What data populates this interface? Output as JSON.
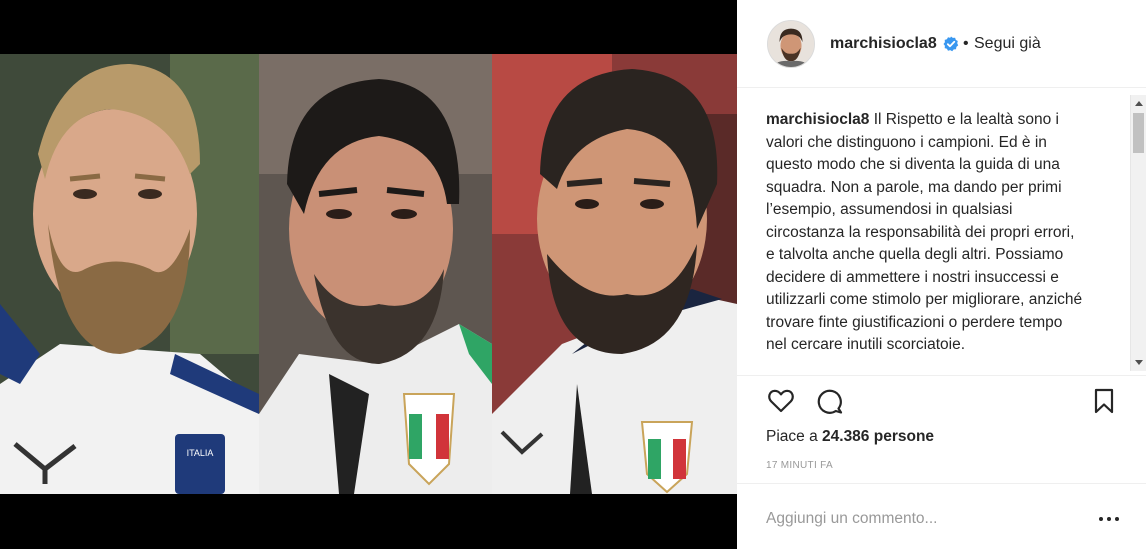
{
  "post": {
    "image_alt": "Tre ritratti di calciatori della nazionale italiana",
    "panels": [
      {
        "name": "player-1",
        "hair": "#b89a6a",
        "beard": "#8a6a44",
        "skin": "#d9a88a",
        "shirt": "#f2f2f2",
        "bg": "#3f4a3a"
      },
      {
        "name": "player-2",
        "hair": "#1d1a18",
        "beard": "#3b332d",
        "skin": "#c99076",
        "shirt": "#ededed",
        "bg": "#5e5650"
      },
      {
        "name": "player-3",
        "hair": "#2a2420",
        "beard": "#2f2621",
        "skin": "#cf9676",
        "shirt": "#efefef",
        "bg": "#8a3a38"
      }
    ],
    "badge_text": "ITALIA"
  },
  "header": {
    "username": "marchisiocla8",
    "separator": "•",
    "follow_label": "Segui già",
    "verified_icon": "verified-badge-icon",
    "verified_color": "#3897f0"
  },
  "caption": {
    "username": "marchisiocla8",
    "text": "Il Rispetto e la lealtà sono i valori che distinguono i campioni. Ed è in questo modo che si diventa la guida di una squadra. Non a parole, ma dando per primi l’esempio, assumendosi in qualsiasi circostanza la responsabilità dei propri errori, e talvolta anche quella degli altri. Possiamo decidere di ammettere i nostri insuccessi e utilizzarli come stimolo per migliorare, anziché trovare finte giustificazioni o perdere tempo nel cercare inutili scorciatoie."
  },
  "actions": {
    "like_icon": "heart-icon",
    "comment_icon": "comment-bubble-icon",
    "save_icon": "bookmark-icon"
  },
  "likes": {
    "prefix": "Piace a ",
    "count": "24.386 persone"
  },
  "timestamp": "17 MINUTI FA",
  "comment": {
    "placeholder": "Aggiungi un commento...",
    "more_icon": "more-options-icon"
  }
}
